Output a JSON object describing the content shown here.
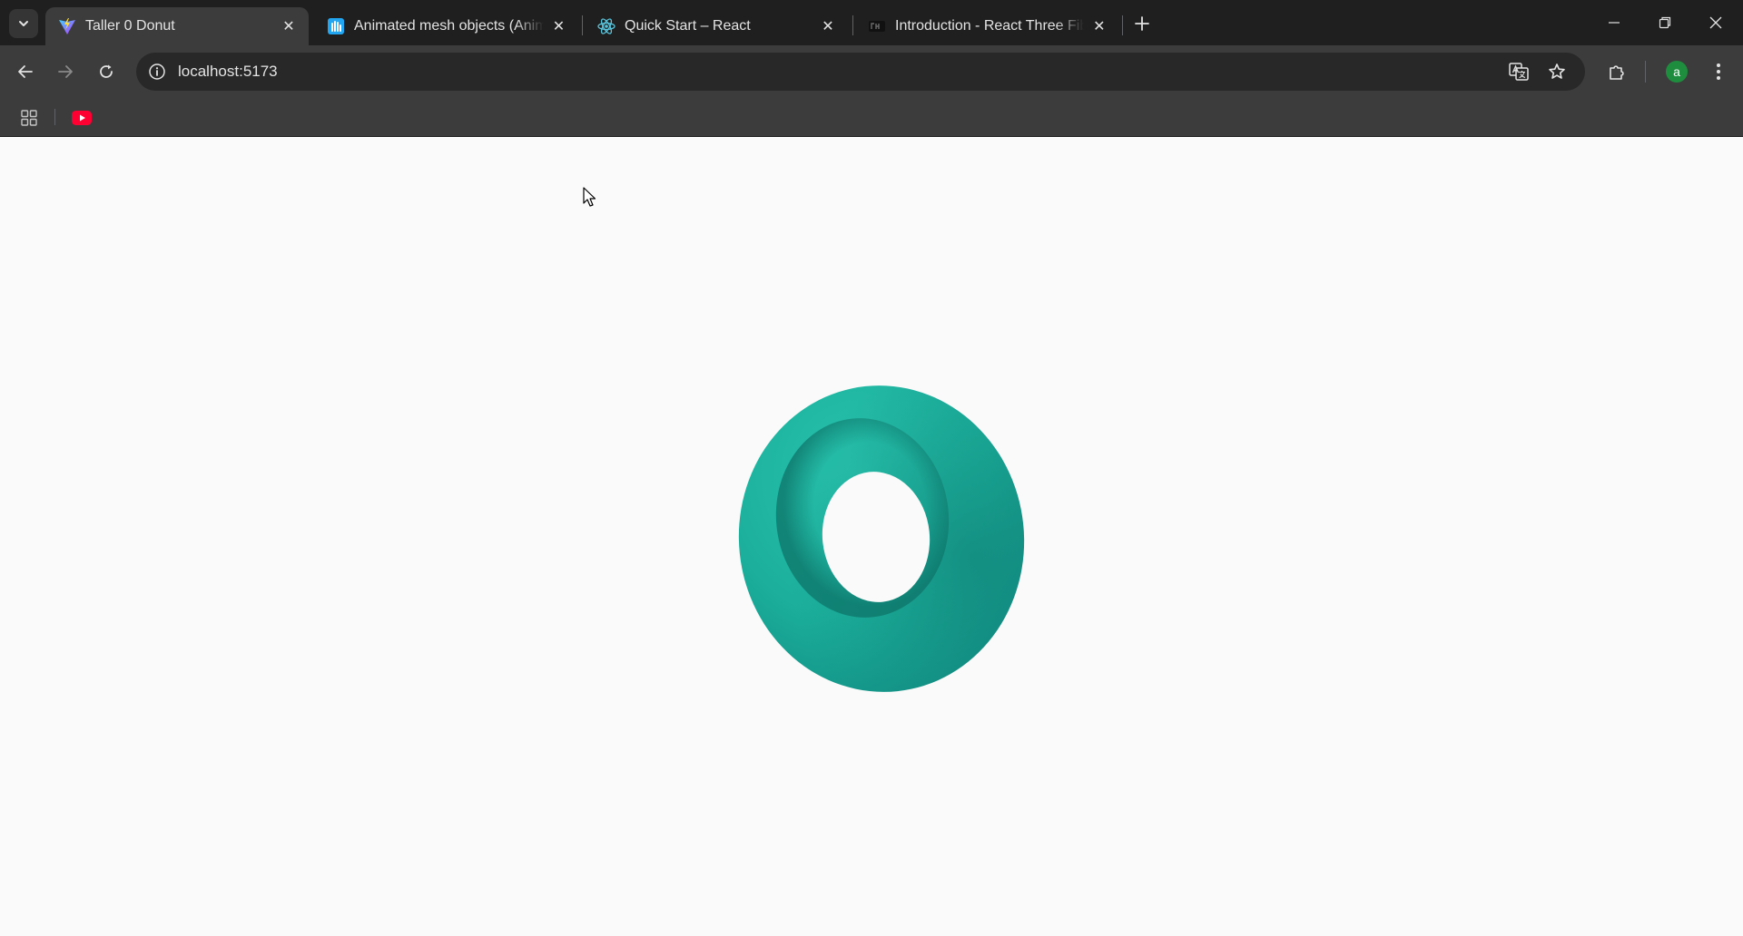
{
  "browser": {
    "tabs": [
      {
        "title": "Taller 0 Donut",
        "favicon": "vite-logo-icon",
        "active": true
      },
      {
        "title": "Animated mesh objects (Animated",
        "favicon": "spline-hand-icon",
        "active": false
      },
      {
        "title": "Quick Start – React",
        "favicon": "react-logo-icon",
        "active": false
      },
      {
        "title": "Introduction - React Three Fiber",
        "favicon": "r3f-logo-icon",
        "active": false
      }
    ],
    "address": {
      "url": "localhost:5173"
    },
    "profile_initial": "a"
  },
  "scene": {
    "object": "torus",
    "color": "#1fb8a3",
    "background": "#fafafa"
  },
  "colors": {
    "tabstrip": "#1f1f1f",
    "toolbar": "#3c3c3c",
    "omnibox": "#282828",
    "text": "#e3e3e3",
    "youtube": "#ff0033",
    "avatar": "#1e8e3e"
  }
}
